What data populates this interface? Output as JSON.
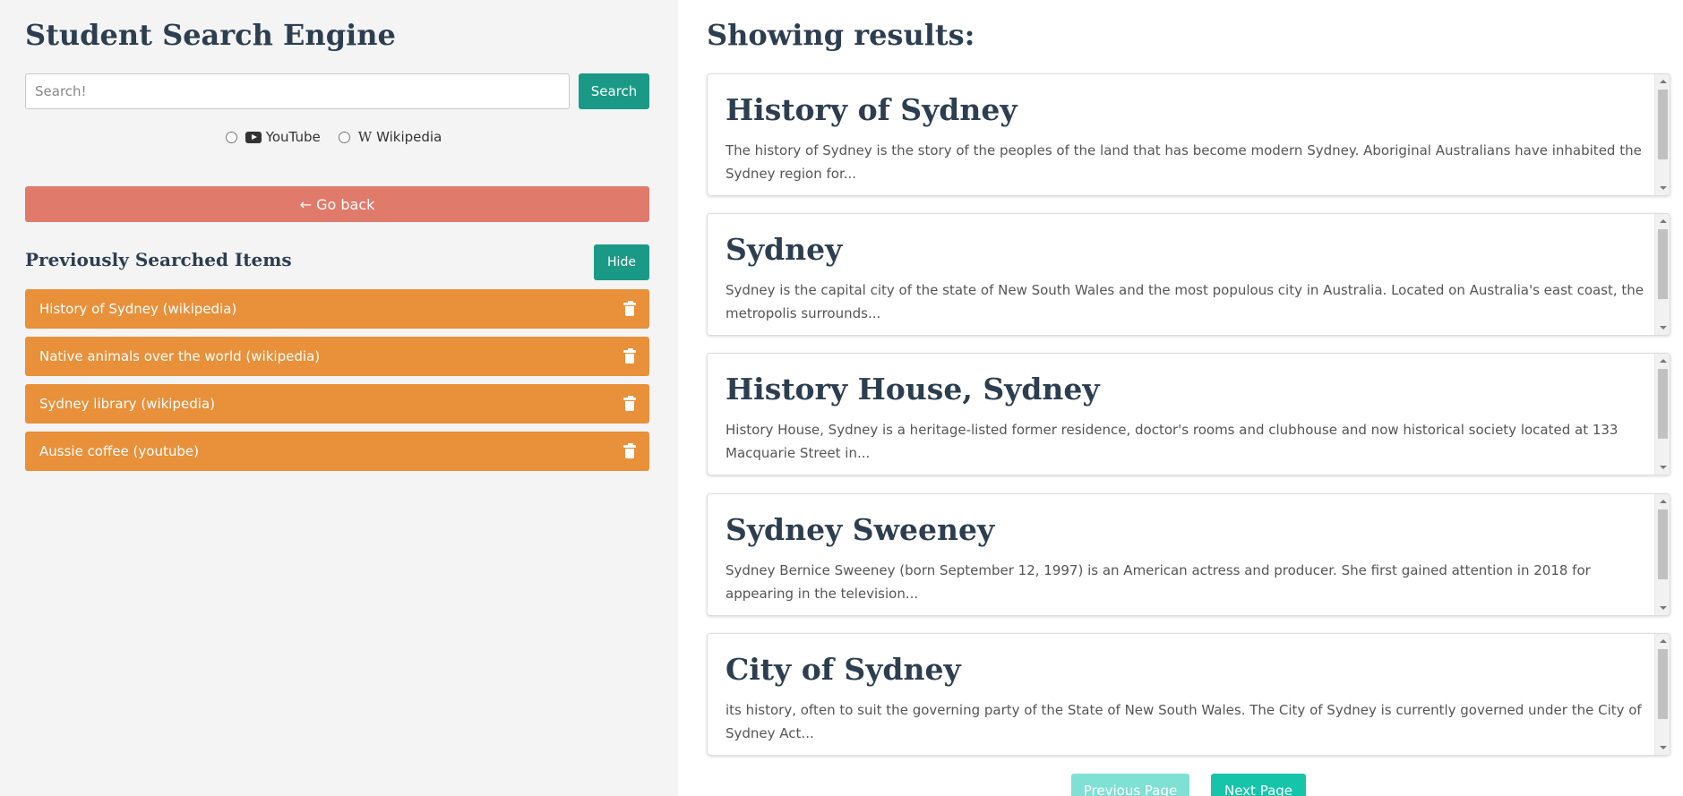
{
  "app": {
    "title": "Student Search Engine"
  },
  "search": {
    "placeholder": "Search!",
    "value": "",
    "button_label": "Search"
  },
  "sources": [
    {
      "label": "YouTube",
      "icon": "youtube-icon"
    },
    {
      "label": "Wikipedia",
      "icon": "wikipedia-icon",
      "glyph": "W"
    }
  ],
  "back_button": {
    "label": "← Go back"
  },
  "history": {
    "title": "Previously Searched Items",
    "hide_label": "Hide",
    "items": [
      {
        "label": "History of Sydney (wikipedia)"
      },
      {
        "label": "Native animals over the world (wikipedia)"
      },
      {
        "label": "Sydney library (wikipedia)"
      },
      {
        "label": "Aussie coffee (youtube)"
      }
    ]
  },
  "results": {
    "title": "Showing results:",
    "items": [
      {
        "title": "History of Sydney",
        "desc": "The history of Sydney is the story of the peoples of the land that has become modern Sydney. Aboriginal Australians have inhabited the Sydney region for..."
      },
      {
        "title": "Sydney",
        "desc": "Sydney is the capital city of the state of New South Wales and the most populous city in Australia. Located on Australia's east coast, the metropolis surrounds..."
      },
      {
        "title": "History House, Sydney",
        "desc": "History House, Sydney is a heritage-listed former residence, doctor's rooms and clubhouse and now historical society located at 133 Macquarie Street in..."
      },
      {
        "title": "Sydney Sweeney",
        "desc": "Sydney Bernice Sweeney (born September 12, 1997) is an American actress and producer. She first gained attention in 2018 for appearing in the television..."
      },
      {
        "title": "City of Sydney",
        "desc": "its history, often to suit the governing party of the State of New South Wales. The City of Sydney is currently governed under the City of Sydney Act..."
      }
    ]
  },
  "pager": {
    "prev_label": "Previous Page",
    "next_label": "Next Page"
  },
  "colors": {
    "teal": "#1a9a86",
    "back_red": "#e07b6b",
    "history_orange": "#e8903a",
    "heading": "#2c3e50",
    "next_button": "#15c4a9",
    "prev_button": "#7fe0d4"
  }
}
